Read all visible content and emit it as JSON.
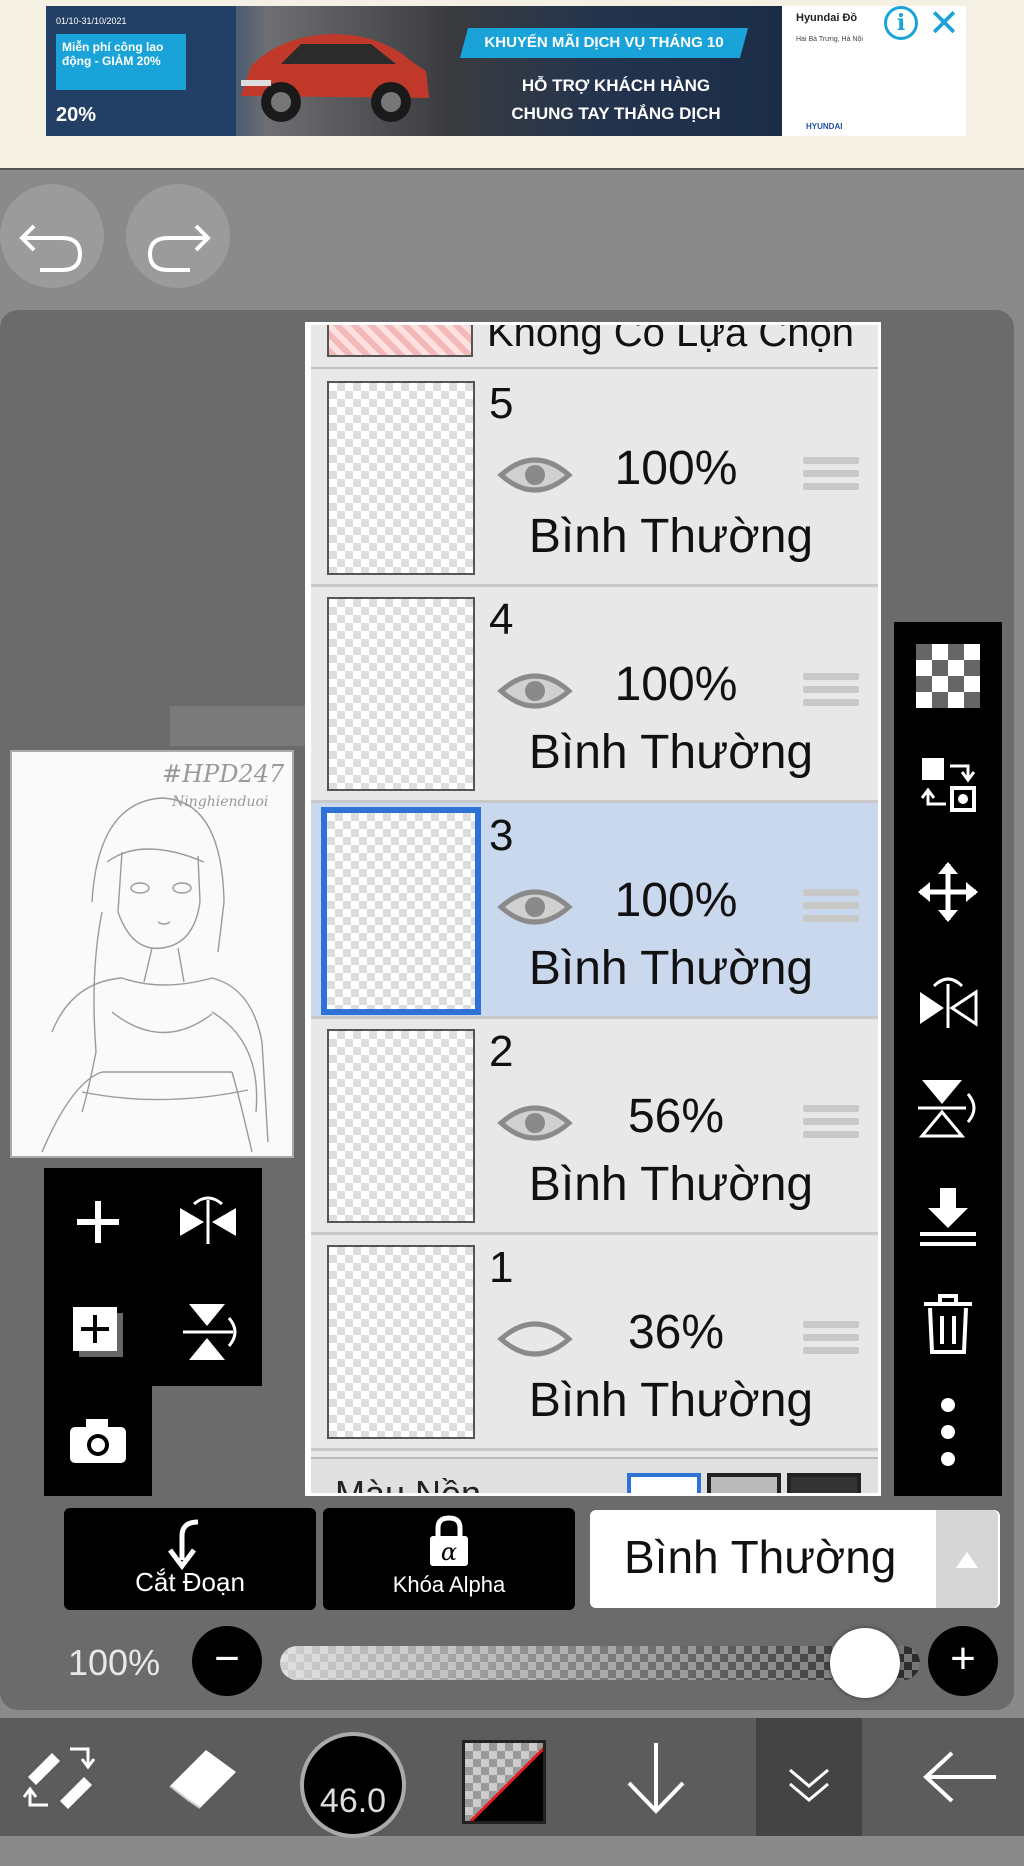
{
  "ad": {
    "header_small": "01/10-31/10/2021",
    "badge_text": "Miễn phí công lao động - GIẢM 20%",
    "bottom_pct": "20%",
    "strip": "KHUYẾN MÃI DỊCH VỤ THÁNG 10",
    "line1": "HỖ TRỢ KHÁCH HÀNG",
    "line2": "CHUNG TAY THẮNG DỊCH",
    "brand": "Hyundai Đồ",
    "brand_sub": "Hai Bà Trưng, Hà Nội",
    "footer": "HYUNDAI",
    "info_glyph": "i",
    "close_glyph": "✕"
  },
  "layers_panel": {
    "top_partial_label": "Không Có Lựa Chọn",
    "layers": [
      {
        "number": "5",
        "opacity": "100%",
        "mode": "Bình Thường",
        "visible": true,
        "selected": false
      },
      {
        "number": "4",
        "opacity": "100%",
        "mode": "Bình Thường",
        "visible": true,
        "selected": false
      },
      {
        "number": "3",
        "opacity": "100%",
        "mode": "Bình Thường",
        "visible": true,
        "selected": true
      },
      {
        "number": "2",
        "opacity": "56%",
        "mode": "Bình Thường",
        "visible": true,
        "selected": false
      },
      {
        "number": "1",
        "opacity": "36%",
        "mode": "Bình Thường",
        "visible": false,
        "selected": false
      }
    ],
    "background_label": "Màu Nền"
  },
  "thumbnail": {
    "caption": "#HPD247",
    "caption2": "Ninghienduoi"
  },
  "controls": {
    "clip_label": "Cắt Đoạn",
    "alpha_label": "Khóa Alpha",
    "alpha_glyph": "α",
    "blend_mode": "Bình Thường",
    "opacity_label": "100%",
    "opacity_value": 1.0,
    "minus": "−",
    "plus": "+"
  },
  "bottom_bar": {
    "brush_size": "46.0"
  },
  "colors": {
    "selected_layer_bg": "#cad8ee",
    "selection_border": "#2f72d6",
    "ad_accent": "#1aa3d8"
  }
}
